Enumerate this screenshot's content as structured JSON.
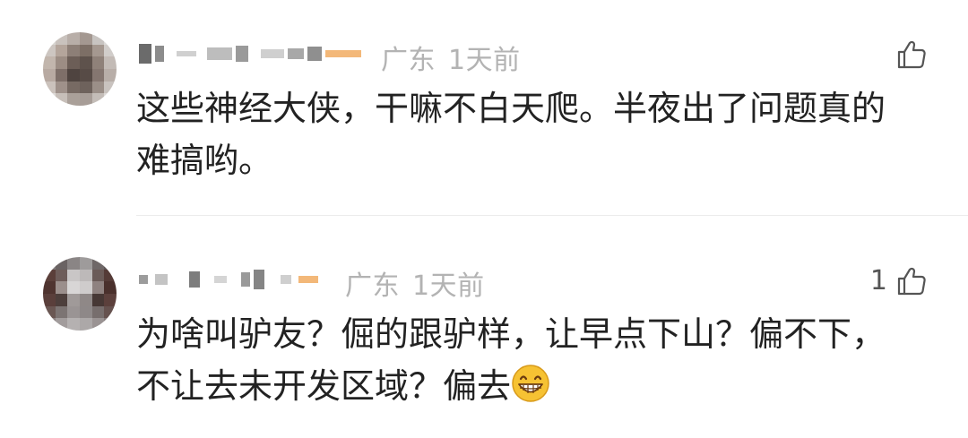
{
  "comments": [
    {
      "location": "广东",
      "time": "1天前",
      "like_count": "",
      "text_line1": "这些神经大侠，干嘛不白天爬。半夜出了问题真的",
      "text_line2": "难搞哟。"
    },
    {
      "location": "广东",
      "time": "1天前",
      "like_count": "1",
      "text_line1": "为啥叫驴友？倔的跟驴样，让早点下山？偏不下，",
      "text_line2": "不让去未开发区域？偏去"
    }
  ],
  "colors": {
    "meta": "#b3b3b3",
    "text": "#222222",
    "divider": "#ececec",
    "emoji": "#f6c233"
  },
  "icons": [
    "thumbs-up-icon",
    "grinning-emoji-icon"
  ]
}
